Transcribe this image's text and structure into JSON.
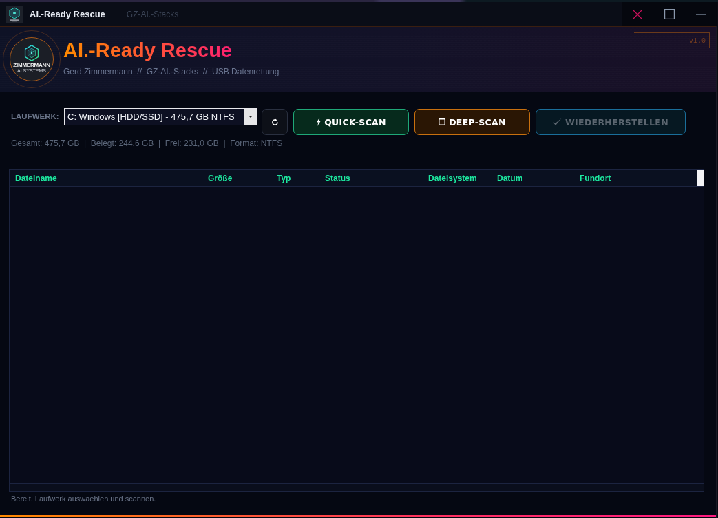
{
  "window": {
    "title": "AI.-Ready Rescue",
    "subtitle": "GZ-AI.-Stacks"
  },
  "header": {
    "title": "AI.-Ready Rescue",
    "subtitle": "Gerd Zimmermann  //  GZ-AI.-Stacks  //  USB Datenrettung",
    "version": "v1.0",
    "logo": {
      "name": "ZIMMERMANN",
      "tagline": "AI SYSTEMS"
    }
  },
  "toolbar": {
    "drive_label": "LAUFWERK:",
    "drive_select": {
      "value": "C: Windows [HDD/SSD] - 475,7 GB NTFS"
    },
    "buttons": [
      {
        "kind": "refresh",
        "disabled": false
      },
      {
        "kind": "quick",
        "label": "QUICK-SCAN",
        "disabled": false
      },
      {
        "kind": "deep",
        "label": "DEEP-SCAN",
        "disabled": false
      },
      {
        "kind": "restore",
        "label": "WIEDERHERSTELLEN",
        "disabled": true
      }
    ]
  },
  "drive_info": "Gesamt: 475,7 GB  |  Belegt: 244,6 GB  |  Frei: 231,0 GB  |  Format: NTFS",
  "table": {
    "columns": [
      "Dateiname",
      "Größe",
      "Typ",
      "Status",
      "Dateisystem",
      "Datum",
      "Fundort"
    ]
  },
  "status_bar": "Bereit. Laufwerk auswaehlen und scannen."
}
